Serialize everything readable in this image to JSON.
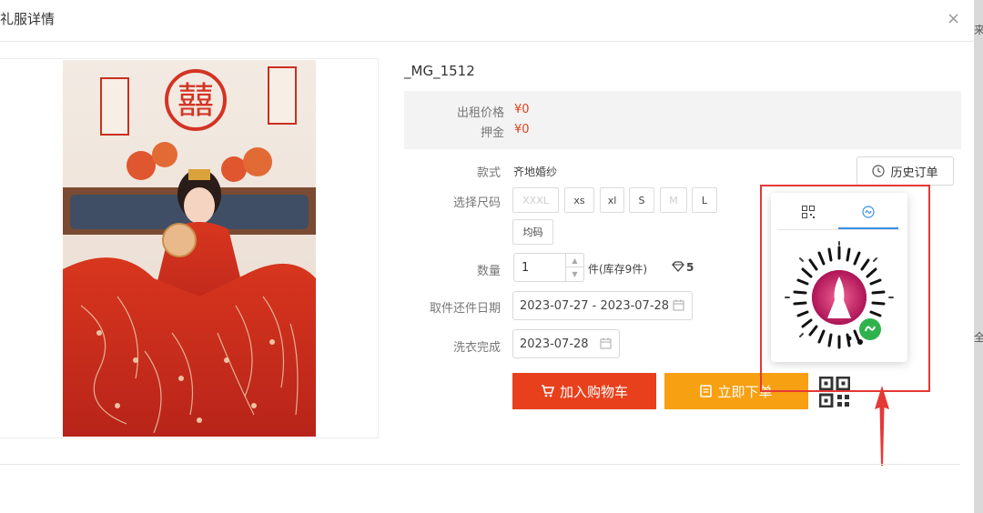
{
  "dialog": {
    "title": "礼服详情",
    "close_glyph": "×"
  },
  "product": {
    "name": "_MG_1512",
    "rent_price_label": "出租价格",
    "rent_price": "¥0",
    "deposit_label": "押金",
    "deposit": "¥0",
    "style_label": "款式",
    "style": "齐地婚纱",
    "size_label": "选择尺码",
    "sizes": [
      {
        "label": "XXXL",
        "enabled": false
      },
      {
        "label": "xs",
        "enabled": true
      },
      {
        "label": "xl",
        "enabled": true
      },
      {
        "label": "S",
        "enabled": true
      },
      {
        "label": "M",
        "enabled": false
      },
      {
        "label": "L",
        "enabled": true
      },
      {
        "label": "均码",
        "enabled": true
      }
    ],
    "qty_label": "数量",
    "qty": "1",
    "stock_text": "件(库存9件)",
    "points": "5",
    "pickup_label": "取件还件日期",
    "pickup_range": "2023-07-27 - 2023-07-28",
    "wash_label": "洗衣完成",
    "wash_date": "2023-07-28"
  },
  "actions": {
    "history_label": "历史订单",
    "cart_label": "加入购物车",
    "order_label": "立即下单"
  },
  "colors": {
    "accent_red": "#e8401c",
    "accent_orange": "#f7a012",
    "price_red": "#e2421e",
    "tab_blue": "#3a8ee6",
    "annotation_red": "#e53935"
  },
  "icons": [
    "close-icon",
    "clock-icon",
    "cart-icon",
    "document-icon",
    "qr-code-icon",
    "mini-program-icon",
    "calendar-icon",
    "diamond-icon",
    "wechat-mini-program-code"
  ],
  "side_peek": {
    "top": "来",
    "bottom": "全"
  }
}
